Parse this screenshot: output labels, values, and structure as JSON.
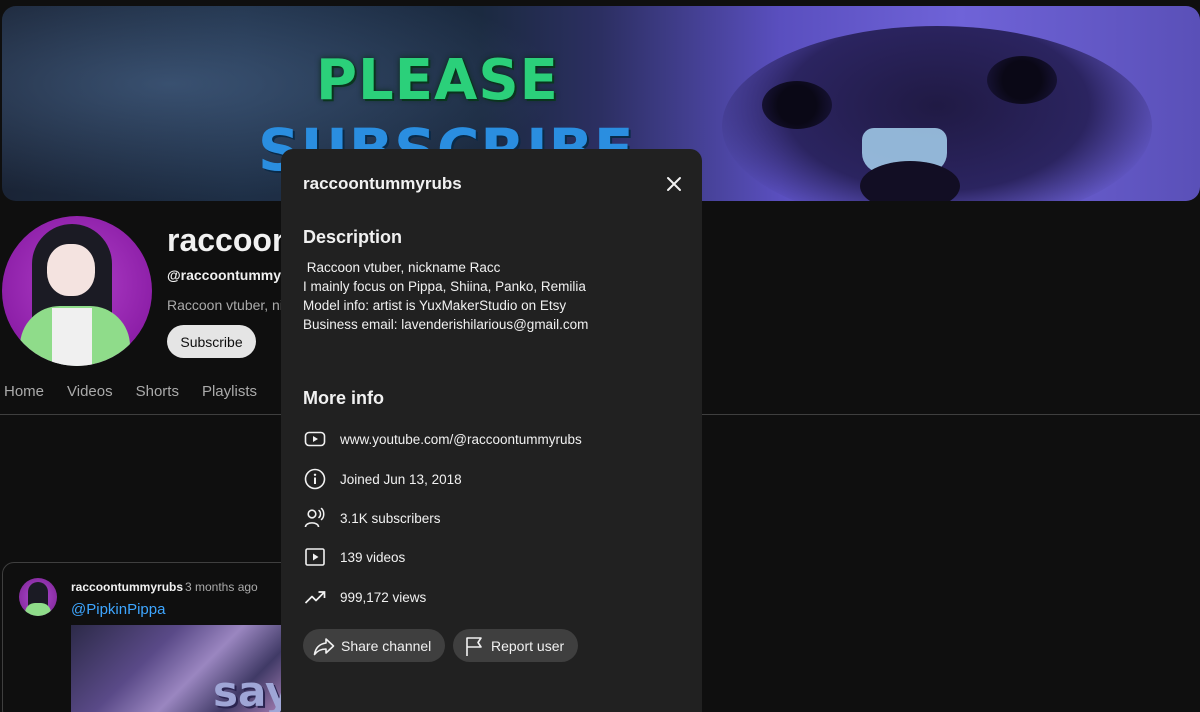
{
  "banner": {
    "line1": "PLEASE",
    "line2": "SUBSCRIBE"
  },
  "channel": {
    "name": "raccoon",
    "handle": "@raccoontummyrul",
    "description": "Raccoon vtuber, nic",
    "subscribe_label": "Subscribe"
  },
  "tabs": [
    {
      "label": "Home"
    },
    {
      "label": "Videos"
    },
    {
      "label": "Shorts"
    },
    {
      "label": "Playlists"
    }
  ],
  "post": {
    "author": "raccoontummyrubs",
    "time": "3 months ago",
    "mention": "@PipkinPippa",
    "image_text": "say"
  },
  "modal": {
    "title": "raccoontummyrubs",
    "description_heading": "Description",
    "description_text": " Raccoon vtuber, nickname Racc\nI mainly focus on Pippa, Shiina, Panko, Remilia\nModel info: artist is YuxMakerStudio on Etsy\nBusiness email: lavenderishilarious@gmail.com",
    "more_info_heading": "More info",
    "info": [
      {
        "icon": "youtube-icon",
        "text": "www.youtube.com/@raccoontummyrubs"
      },
      {
        "icon": "info-icon",
        "text": "Joined Jun 13, 2018"
      },
      {
        "icon": "subscribers-icon",
        "text": "3.1K subscribers"
      },
      {
        "icon": "videos-icon",
        "text": "139 videos"
      },
      {
        "icon": "trending-icon",
        "text": "999,172 views"
      }
    ],
    "share_label": "Share channel",
    "report_label": "Report user"
  },
  "colors": {
    "background": "#0f0f0f",
    "modal": "#212121",
    "pill": "#3f3f3f",
    "link": "#3ea6ff",
    "banner_green": "#2bd07a",
    "banner_blue": "#2a8ee0"
  }
}
